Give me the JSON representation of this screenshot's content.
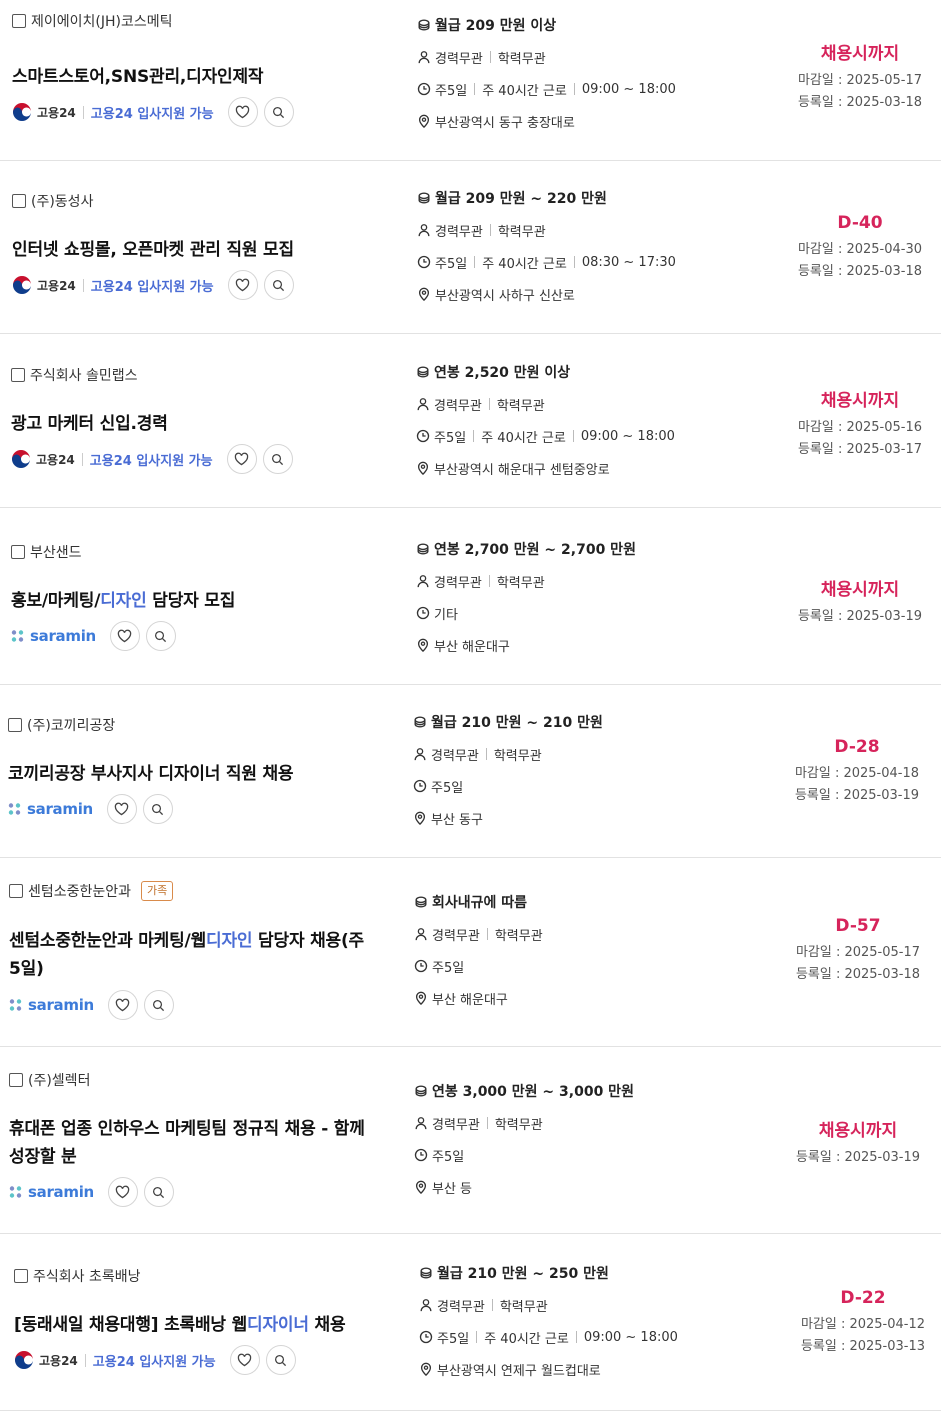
{
  "colors": {
    "accent": "#d6245b",
    "link": "#4a6cd4",
    "saramin": "#3d7bd9",
    "badge": "#c0702a"
  },
  "jobs": [
    {
      "company": "제이에이치(JH)코스메틱",
      "badge": "",
      "title_parts": [
        {
          "t": "스마트스토어,SNS관리,디자인제작",
          "hl": false
        }
      ],
      "source": "gov24",
      "gov24_label": "고용24",
      "gov24_link": "고용24 입사지원 가능",
      "salary": "월급 209 만원 이상",
      "career": "경력무관",
      "edu": "학력무관",
      "schedule": [
        "주5일",
        "주 40시간 근로",
        "09:00 ~ 18:00"
      ],
      "location": "부산광역시 동구 충장대로",
      "deadline_label": "채용시까지",
      "deadline": "마감일 : 2025-05-17",
      "registered": "등록일 : 2025-03-18"
    },
    {
      "company": "(주)동성사",
      "badge": "",
      "title_parts": [
        {
          "t": "인터넷 쇼핑몰, 오픈마켓 관리 직원 모집",
          "hl": false
        }
      ],
      "source": "gov24",
      "gov24_label": "고용24",
      "gov24_link": "고용24 입사지원 가능",
      "salary": "월급 209 만원 ~ 220 만원",
      "career": "경력무관",
      "edu": "학력무관",
      "schedule": [
        "주5일",
        "주 40시간 근로",
        "08:30 ~ 17:30"
      ],
      "location": "부산광역시 사하구 신산로",
      "deadline_label": "D-40",
      "deadline": "마감일 : 2025-04-30",
      "registered": "등록일 : 2025-03-18"
    },
    {
      "company": "주식회사 솔민랩스",
      "badge": "",
      "title_parts": [
        {
          "t": "광고 마케터 신입.경력",
          "hl": false
        }
      ],
      "source": "gov24",
      "gov24_label": "고용24",
      "gov24_link": "고용24 입사지원 가능",
      "salary": "연봉 2,520 만원 이상",
      "career": "경력무관",
      "edu": "학력무관",
      "schedule": [
        "주5일",
        "주 40시간 근로",
        "09:00 ~ 18:00"
      ],
      "location": "부산광역시 해운대구 센텀중앙로",
      "deadline_label": "채용시까지",
      "deadline": "마감일 : 2025-05-16",
      "registered": "등록일 : 2025-03-17"
    },
    {
      "company": "부산샌드",
      "badge": "",
      "title_parts": [
        {
          "t": "홍보/마케팅/",
          "hl": false
        },
        {
          "t": "디자인",
          "hl": true
        },
        {
          "t": " 담당자 모집",
          "hl": false
        }
      ],
      "source": "saramin",
      "saramin_label": "saramin",
      "salary": "연봉 2,700 만원 ~ 2,700 만원",
      "career": "경력무관",
      "edu": "학력무관",
      "schedule": [
        "기타"
      ],
      "location": "부산 해운대구",
      "deadline_label": "채용시까지",
      "deadline": "",
      "registered": "등록일 : 2025-03-19"
    },
    {
      "company": "(주)코끼리공장",
      "badge": "",
      "title_parts": [
        {
          "t": "코끼리공장 부사지사 디자이너 직원 채용",
          "hl": false
        }
      ],
      "source": "saramin",
      "saramin_label": "saramin",
      "salary": "월급 210 만원 ~ 210 만원",
      "career": "경력무관",
      "edu": "학력무관",
      "schedule": [
        "주5일"
      ],
      "location": "부산 동구",
      "deadline_label": "D-28",
      "deadline": "마감일 : 2025-04-18",
      "registered": "등록일 : 2025-03-19"
    },
    {
      "company": "센텀소중한눈안과",
      "badge": "가족",
      "title_parts": [
        {
          "t": "센텀소중한눈안과 마케팅/웹",
          "hl": false
        },
        {
          "t": "디자인",
          "hl": true
        },
        {
          "t": " 담당자 채용(주5일)",
          "hl": false
        }
      ],
      "source": "saramin",
      "saramin_label": "saramin",
      "salary": "회사내규에 따름",
      "career": "경력무관",
      "edu": "학력무관",
      "schedule": [
        "주5일"
      ],
      "location": "부산 해운대구",
      "deadline_label": "D-57",
      "deadline": "마감일 : 2025-05-17",
      "registered": "등록일 : 2025-03-18"
    },
    {
      "company": "(주)셀렉터",
      "badge": "",
      "title_parts": [
        {
          "t": "휴대폰 업종 인하우스 마케팅팀 정규직 채용 - 함께 성장할 분",
          "hl": false
        }
      ],
      "source": "saramin",
      "saramin_label": "saramin",
      "salary": "연봉 3,000 만원 ~ 3,000 만원",
      "career": "경력무관",
      "edu": "학력무관",
      "schedule": [
        "주5일"
      ],
      "location": "부산 등",
      "deadline_label": "채용시까지",
      "deadline": "",
      "registered": "등록일 : 2025-03-19"
    },
    {
      "company": "주식회사 초록배낭",
      "badge": "",
      "title_parts": [
        {
          "t": "[동래새일 채용대행] 초록배낭 웹",
          "hl": false
        },
        {
          "t": "디자이너",
          "hl": true
        },
        {
          "t": " 채용",
          "hl": false
        }
      ],
      "source": "gov24",
      "gov24_label": "고용24",
      "gov24_link": "고용24 입사지원 가능",
      "salary": "월급 210 만원 ~ 250 만원",
      "career": "경력무관",
      "edu": "학력무관",
      "schedule": [
        "주5일",
        "주 40시간 근로",
        "09:00 ~ 18:00"
      ],
      "location": "부산광역시 연제구 월드컵대로",
      "deadline_label": "D-22",
      "deadline": "마감일 : 2025-04-12",
      "registered": "등록일 : 2025-03-13"
    }
  ]
}
